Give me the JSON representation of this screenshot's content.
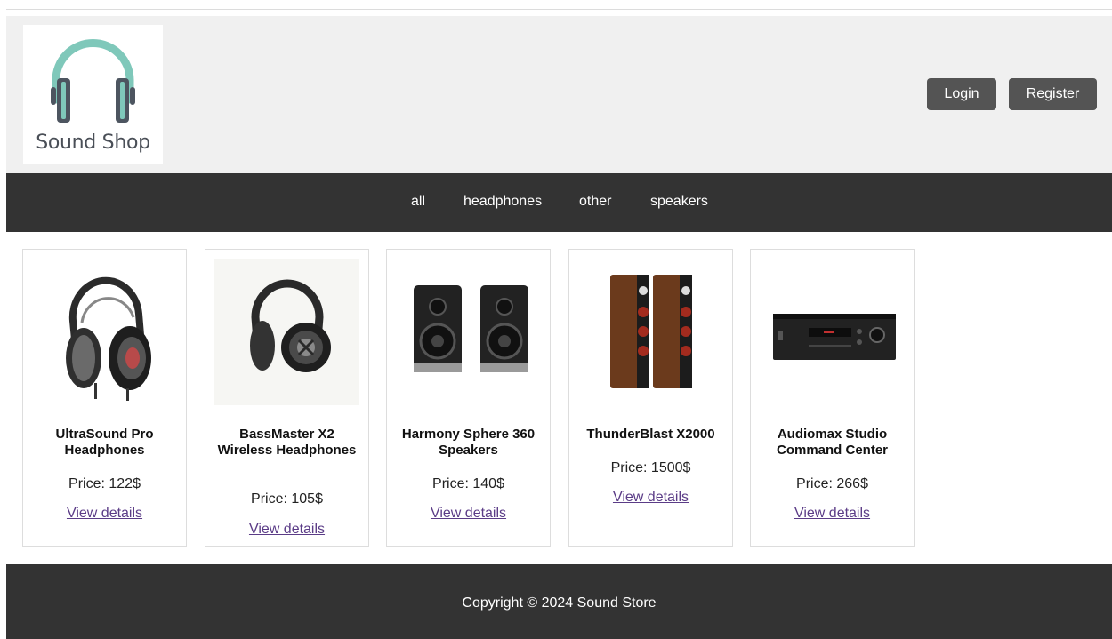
{
  "brand": {
    "name": "Sound Shop",
    "logo_icon": "headphones-icon",
    "logo_colors": {
      "band": "#7fc8ba",
      "cups": "#4d5560"
    }
  },
  "header": {
    "login_label": "Login",
    "register_label": "Register"
  },
  "nav": {
    "items": [
      {
        "label": "all"
      },
      {
        "label": "headphones"
      },
      {
        "label": "other"
      },
      {
        "label": "speakers"
      }
    ]
  },
  "products": [
    {
      "name": "UltraSound Pro Headphones",
      "price": "Price: 122$",
      "link": "View details",
      "image": "over-ear-headphones-image"
    },
    {
      "name": "BassMaster X2 Wireless Headphones",
      "price": "Price: 105$",
      "link": "View details",
      "image": "wireless-headphones-image"
    },
    {
      "name": "Harmony Sphere 360 Speakers",
      "price": "Price: 140$",
      "link": "View details",
      "image": "bookshelf-speakers-image"
    },
    {
      "name": "ThunderBlast X2000",
      "price": "Price: 1500$",
      "link": "View details",
      "image": "floorstanding-speakers-image"
    },
    {
      "name": "Audiomax Studio Command Center",
      "price": "Price: 266$",
      "link": "View details",
      "image": "av-receiver-image"
    }
  ],
  "footer": {
    "copyright": "Copyright © 2024 Sound Store"
  },
  "colors": {
    "header_bg": "#f0f0f0",
    "nav_bg": "#333333",
    "button_bg": "#545454",
    "link": "#5b3c87"
  }
}
